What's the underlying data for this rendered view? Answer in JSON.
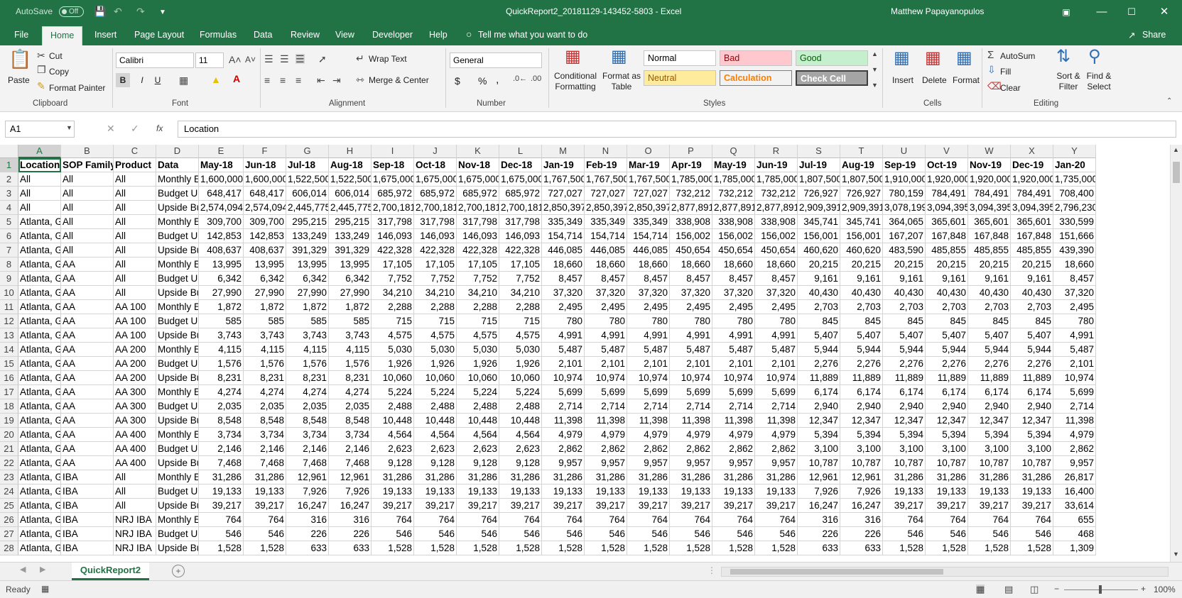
{
  "titlebar": {
    "autosave_label": "AutoSave",
    "autosave_state": "Off",
    "window_title": "QuickReport2_20181129-143452-5803  -  Excel",
    "user_name": "Matthew Papayanopulos"
  },
  "menu": {
    "items": [
      "File",
      "Home",
      "Insert",
      "Page Layout",
      "Formulas",
      "Data",
      "Review",
      "View",
      "Developer",
      "Help"
    ],
    "tell_me": "Tell me what you want to do",
    "share": "Share"
  },
  "ribbon": {
    "clipboard": {
      "paste": "Paste",
      "cut": "Cut",
      "copy": "Copy",
      "format_painter": "Format Painter",
      "group": "Clipboard"
    },
    "font": {
      "name": "Calibri",
      "size": "11",
      "group": "Font",
      "bold": "B",
      "italic": "I",
      "underline": "U"
    },
    "alignment": {
      "wrap_text": "Wrap Text",
      "merge": "Merge & Center",
      "group": "Alignment"
    },
    "number": {
      "format": "General",
      "currency": "$",
      "percent": "%",
      "comma": ",",
      "group": "Number"
    },
    "styles": {
      "conditional": "Conditional Formatting",
      "format_table": "Format as Table",
      "normal": "Normal",
      "bad": "Bad",
      "good": "Good",
      "neutral": "Neutral",
      "calculation": "Calculation",
      "check_cell": "Check Cell",
      "group": "Styles"
    },
    "cells": {
      "insert": "Insert",
      "delete": "Delete",
      "format": "Format",
      "group": "Cells"
    },
    "editing": {
      "autosum": "AutoSum",
      "fill": "Fill",
      "clear": "Clear",
      "sort_filter": "Sort & Filter",
      "find_select": "Find & Select",
      "group": "Editing"
    }
  },
  "formula_bar": {
    "name_box": "A1",
    "fx": "fx",
    "content": "Location"
  },
  "sheet": {
    "columns": [
      "A",
      "B",
      "C",
      "D",
      "E",
      "F",
      "G",
      "H",
      "I",
      "J",
      "K",
      "L",
      "M",
      "N",
      "O",
      "P",
      "Q",
      "R",
      "S",
      "T",
      "U",
      "V",
      "W",
      "X",
      "Y"
    ],
    "header": [
      "Location",
      "SOP Family",
      "Product",
      "Data",
      "May-18",
      "Jun-18",
      "Jul-18",
      "Aug-18",
      "Sep-18",
      "Oct-18",
      "Nov-18",
      "Dec-18",
      "Jan-19",
      "Feb-19",
      "Mar-19",
      "Apr-19",
      "May-19",
      "Jun-19",
      "Jul-19",
      "Aug-19",
      "Sep-19",
      "Oct-19",
      "Nov-19",
      "Dec-19",
      "Jan-20"
    ],
    "rows": [
      [
        "All",
        "All",
        "All",
        "Monthly E",
        "1,600,000",
        "1,600,000",
        "1,522,500",
        "1,522,500",
        "1,675,000",
        "1,675,000",
        "1,675,000",
        "1,675,000",
        "1,767,500",
        "1,767,500",
        "1,767,500",
        "1,785,000",
        "1,785,000",
        "1,785,000",
        "1,807,500",
        "1,807,500",
        "1,910,000",
        "1,920,000",
        "1,920,000",
        "1,920,000",
        "1,735,000"
      ],
      [
        "All",
        "All",
        "All",
        "Budget Ur",
        "648,417",
        "648,417",
        "606,014",
        "606,014",
        "685,972",
        "685,972",
        "685,972",
        "685,972",
        "727,027",
        "727,027",
        "727,027",
        "732,212",
        "732,212",
        "732,212",
        "726,927",
        "726,927",
        "780,159",
        "784,491",
        "784,491",
        "784,491",
        "708,400"
      ],
      [
        "All",
        "All",
        "All",
        "Upside Bu",
        "2,574,094",
        "2,574,094",
        "2,445,775",
        "2,445,775",
        "2,700,181",
        "2,700,181",
        "2,700,181",
        "2,700,181",
        "2,850,397",
        "2,850,397",
        "2,850,397",
        "2,877,891",
        "2,877,891",
        "2,877,891",
        "2,909,391",
        "2,909,391",
        "3,078,199",
        "3,094,395",
        "3,094,395",
        "3,094,395",
        "2,796,230"
      ],
      [
        "Atlanta, G",
        "All",
        "All",
        "Monthly E",
        "309,700",
        "309,700",
        "295,215",
        "295,215",
        "317,798",
        "317,798",
        "317,798",
        "317,798",
        "335,349",
        "335,349",
        "335,349",
        "338,908",
        "338,908",
        "338,908",
        "345,741",
        "345,741",
        "364,065",
        "365,601",
        "365,601",
        "365,601",
        "330,599"
      ],
      [
        "Atlanta, G",
        "All",
        "All",
        "Budget Ur",
        "142,853",
        "142,853",
        "133,249",
        "133,249",
        "146,093",
        "146,093",
        "146,093",
        "146,093",
        "154,714",
        "154,714",
        "154,714",
        "156,002",
        "156,002",
        "156,002",
        "156,001",
        "156,001",
        "167,207",
        "167,848",
        "167,848",
        "167,848",
        "151,666"
      ],
      [
        "Atlanta, G",
        "All",
        "All",
        "Upside Bu",
        "408,637",
        "408,637",
        "391,329",
        "391,329",
        "422,328",
        "422,328",
        "422,328",
        "422,328",
        "446,085",
        "446,085",
        "446,085",
        "450,654",
        "450,654",
        "450,654",
        "460,620",
        "460,620",
        "483,590",
        "485,855",
        "485,855",
        "485,855",
        "439,390"
      ],
      [
        "Atlanta, G",
        "AA",
        "All",
        "Monthly E",
        "13,995",
        "13,995",
        "13,995",
        "13,995",
        "17,105",
        "17,105",
        "17,105",
        "17,105",
        "18,660",
        "18,660",
        "18,660",
        "18,660",
        "18,660",
        "18,660",
        "20,215",
        "20,215",
        "20,215",
        "20,215",
        "20,215",
        "20,215",
        "18,660"
      ],
      [
        "Atlanta, G",
        "AA",
        "All",
        "Budget Ur",
        "6,342",
        "6,342",
        "6,342",
        "6,342",
        "7,752",
        "7,752",
        "7,752",
        "7,752",
        "8,457",
        "8,457",
        "8,457",
        "8,457",
        "8,457",
        "8,457",
        "9,161",
        "9,161",
        "9,161",
        "9,161",
        "9,161",
        "9,161",
        "8,457"
      ],
      [
        "Atlanta, G",
        "AA",
        "All",
        "Upside Bu",
        "27,990",
        "27,990",
        "27,990",
        "27,990",
        "34,210",
        "34,210",
        "34,210",
        "34,210",
        "37,320",
        "37,320",
        "37,320",
        "37,320",
        "37,320",
        "37,320",
        "40,430",
        "40,430",
        "40,430",
        "40,430",
        "40,430",
        "40,430",
        "37,320"
      ],
      [
        "Atlanta, G",
        "AA",
        "AA 100",
        "Monthly E",
        "1,872",
        "1,872",
        "1,872",
        "1,872",
        "2,288",
        "2,288",
        "2,288",
        "2,288",
        "2,495",
        "2,495",
        "2,495",
        "2,495",
        "2,495",
        "2,495",
        "2,703",
        "2,703",
        "2,703",
        "2,703",
        "2,703",
        "2,703",
        "2,495"
      ],
      [
        "Atlanta, G",
        "AA",
        "AA 100",
        "Budget Ur",
        "585",
        "585",
        "585",
        "585",
        "715",
        "715",
        "715",
        "715",
        "780",
        "780",
        "780",
        "780",
        "780",
        "780",
        "845",
        "845",
        "845",
        "845",
        "845",
        "845",
        "780"
      ],
      [
        "Atlanta, G",
        "AA",
        "AA 100",
        "Upside Bu",
        "3,743",
        "3,743",
        "3,743",
        "3,743",
        "4,575",
        "4,575",
        "4,575",
        "4,575",
        "4,991",
        "4,991",
        "4,991",
        "4,991",
        "4,991",
        "4,991",
        "5,407",
        "5,407",
        "5,407",
        "5,407",
        "5,407",
        "5,407",
        "4,991"
      ],
      [
        "Atlanta, G",
        "AA",
        "AA 200",
        "Monthly E",
        "4,115",
        "4,115",
        "4,115",
        "4,115",
        "5,030",
        "5,030",
        "5,030",
        "5,030",
        "5,487",
        "5,487",
        "5,487",
        "5,487",
        "5,487",
        "5,487",
        "5,944",
        "5,944",
        "5,944",
        "5,944",
        "5,944",
        "5,944",
        "5,487"
      ],
      [
        "Atlanta, G",
        "AA",
        "AA 200",
        "Budget Ur",
        "1,576",
        "1,576",
        "1,576",
        "1,576",
        "1,926",
        "1,926",
        "1,926",
        "1,926",
        "2,101",
        "2,101",
        "2,101",
        "2,101",
        "2,101",
        "2,101",
        "2,276",
        "2,276",
        "2,276",
        "2,276",
        "2,276",
        "2,276",
        "2,101"
      ],
      [
        "Atlanta, G",
        "AA",
        "AA 200",
        "Upside Bu",
        "8,231",
        "8,231",
        "8,231",
        "8,231",
        "10,060",
        "10,060",
        "10,060",
        "10,060",
        "10,974",
        "10,974",
        "10,974",
        "10,974",
        "10,974",
        "10,974",
        "11,889",
        "11,889",
        "11,889",
        "11,889",
        "11,889",
        "11,889",
        "10,974"
      ],
      [
        "Atlanta, G",
        "AA",
        "AA 300",
        "Monthly E",
        "4,274",
        "4,274",
        "4,274",
        "4,274",
        "5,224",
        "5,224",
        "5,224",
        "5,224",
        "5,699",
        "5,699",
        "5,699",
        "5,699",
        "5,699",
        "5,699",
        "6,174",
        "6,174",
        "6,174",
        "6,174",
        "6,174",
        "6,174",
        "5,699"
      ],
      [
        "Atlanta, G",
        "AA",
        "AA 300",
        "Budget Ur",
        "2,035",
        "2,035",
        "2,035",
        "2,035",
        "2,488",
        "2,488",
        "2,488",
        "2,488",
        "2,714",
        "2,714",
        "2,714",
        "2,714",
        "2,714",
        "2,714",
        "2,940",
        "2,940",
        "2,940",
        "2,940",
        "2,940",
        "2,940",
        "2,714"
      ],
      [
        "Atlanta, G",
        "AA",
        "AA 300",
        "Upside Bu",
        "8,548",
        "8,548",
        "8,548",
        "8,548",
        "10,448",
        "10,448",
        "10,448",
        "10,448",
        "11,398",
        "11,398",
        "11,398",
        "11,398",
        "11,398",
        "11,398",
        "12,347",
        "12,347",
        "12,347",
        "12,347",
        "12,347",
        "12,347",
        "11,398"
      ],
      [
        "Atlanta, G",
        "AA",
        "AA 400",
        "Monthly E",
        "3,734",
        "3,734",
        "3,734",
        "3,734",
        "4,564",
        "4,564",
        "4,564",
        "4,564",
        "4,979",
        "4,979",
        "4,979",
        "4,979",
        "4,979",
        "4,979",
        "5,394",
        "5,394",
        "5,394",
        "5,394",
        "5,394",
        "5,394",
        "4,979"
      ],
      [
        "Atlanta, G",
        "AA",
        "AA 400",
        "Budget Ur",
        "2,146",
        "2,146",
        "2,146",
        "2,146",
        "2,623",
        "2,623",
        "2,623",
        "2,623",
        "2,862",
        "2,862",
        "2,862",
        "2,862",
        "2,862",
        "2,862",
        "3,100",
        "3,100",
        "3,100",
        "3,100",
        "3,100",
        "3,100",
        "2,862"
      ],
      [
        "Atlanta, G",
        "AA",
        "AA 400",
        "Upside Bu",
        "7,468",
        "7,468",
        "7,468",
        "7,468",
        "9,128",
        "9,128",
        "9,128",
        "9,128",
        "9,957",
        "9,957",
        "9,957",
        "9,957",
        "9,957",
        "9,957",
        "10,787",
        "10,787",
        "10,787",
        "10,787",
        "10,787",
        "10,787",
        "9,957"
      ],
      [
        "Atlanta, G",
        "IBA",
        "All",
        "Monthly E",
        "31,286",
        "31,286",
        "12,961",
        "12,961",
        "31,286",
        "31,286",
        "31,286",
        "31,286",
        "31,286",
        "31,286",
        "31,286",
        "31,286",
        "31,286",
        "31,286",
        "12,961",
        "12,961",
        "31,286",
        "31,286",
        "31,286",
        "31,286",
        "26,817"
      ],
      [
        "Atlanta, G",
        "IBA",
        "All",
        "Budget Ur",
        "19,133",
        "19,133",
        "7,926",
        "7,926",
        "19,133",
        "19,133",
        "19,133",
        "19,133",
        "19,133",
        "19,133",
        "19,133",
        "19,133",
        "19,133",
        "19,133",
        "7,926",
        "7,926",
        "19,133",
        "19,133",
        "19,133",
        "19,133",
        "16,400"
      ],
      [
        "Atlanta, G",
        "IBA",
        "All",
        "Upside Bu",
        "39,217",
        "39,217",
        "16,247",
        "16,247",
        "39,217",
        "39,217",
        "39,217",
        "39,217",
        "39,217",
        "39,217",
        "39,217",
        "39,217",
        "39,217",
        "39,217",
        "16,247",
        "16,247",
        "39,217",
        "39,217",
        "39,217",
        "39,217",
        "33,614"
      ],
      [
        "Atlanta, G",
        "IBA",
        "NRJ IBA",
        "Monthly E",
        "764",
        "764",
        "316",
        "316",
        "764",
        "764",
        "764",
        "764",
        "764",
        "764",
        "764",
        "764",
        "764",
        "764",
        "316",
        "316",
        "764",
        "764",
        "764",
        "764",
        "655"
      ],
      [
        "Atlanta, G",
        "IBA",
        "NRJ IBA",
        "Budget Ur",
        "546",
        "546",
        "226",
        "226",
        "546",
        "546",
        "546",
        "546",
        "546",
        "546",
        "546",
        "546",
        "546",
        "546",
        "226",
        "226",
        "546",
        "546",
        "546",
        "546",
        "468"
      ],
      [
        "Atlanta, G",
        "IBA",
        "NRJ IBA",
        "Upside Bu",
        "1,528",
        "1,528",
        "633",
        "633",
        "1,528",
        "1,528",
        "1,528",
        "1,528",
        "1,528",
        "1,528",
        "1,528",
        "1,528",
        "1,528",
        "1,528",
        "633",
        "633",
        "1,528",
        "1,528",
        "1,528",
        "1,528",
        "1,309"
      ]
    ]
  },
  "tabs": {
    "sheet_name": "QuickReport2",
    "add": "+"
  },
  "status": {
    "ready": "Ready",
    "zoom": "100%",
    "minus": "−",
    "plus": "+"
  }
}
